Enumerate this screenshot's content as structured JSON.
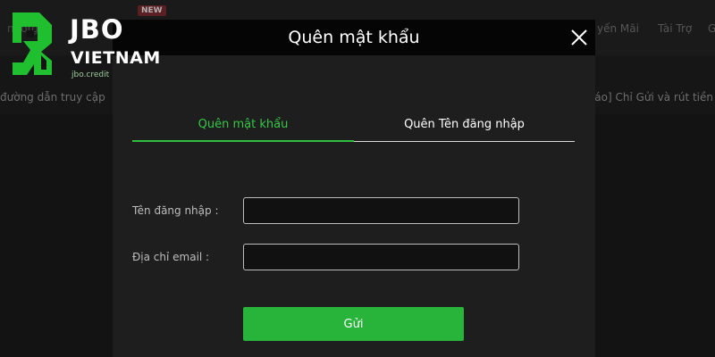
{
  "background": {
    "nav_left": "nporg",
    "new_badge": "NEW",
    "nav_right": [
      {
        "label": "yến Mãi"
      },
      {
        "label": "Tài Trợ"
      },
      {
        "label": "G"
      }
    ],
    "ticker_left": "đường dẫn truy cập",
    "ticker_right": "Báo] Chỉ Gửi và rút tiền"
  },
  "logo": {
    "brand": "JBO",
    "sub": "VIETNAM",
    "domain": "jbo.credit",
    "brand_color": "#1fbf2f"
  },
  "modal": {
    "title": "Quên mật khẩu",
    "close_icon": "close-icon",
    "tabs": [
      {
        "label": "Quên mật khẩu",
        "active": true
      },
      {
        "label": "Quên Tên đăng nhập",
        "active": false
      }
    ],
    "fields": {
      "username": {
        "label": "Tên đăng nhập :",
        "value": "",
        "placeholder": ""
      },
      "email": {
        "label": "Địa chỉ email :",
        "value": "",
        "placeholder": ""
      }
    },
    "submit_label": "Gửi"
  },
  "colors": {
    "accent_green": "#28b33a",
    "active_tab_green": "#34c846",
    "modal_header": "#050505",
    "modal_body": "#1e1e1e"
  }
}
